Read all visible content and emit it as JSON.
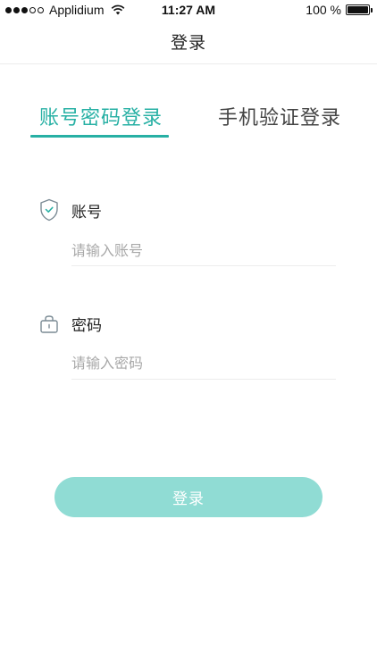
{
  "status_bar": {
    "carrier": "Applidium",
    "time": "11:27 AM",
    "battery": "100 %",
    "signal_icon": "signal-dots-icon",
    "wifi_icon": "wifi-icon",
    "battery_icon": "battery-icon"
  },
  "nav": {
    "title": "登录"
  },
  "tabs": [
    {
      "label": "账号密码登录",
      "active": true
    },
    {
      "label": "手机验证登录",
      "active": false
    }
  ],
  "form": {
    "account": {
      "label": "账号",
      "placeholder": "请输入账号",
      "icon": "shield-icon"
    },
    "password": {
      "label": "密码",
      "placeholder": "请输入密码",
      "icon": "lock-icon"
    }
  },
  "login_button": {
    "label": "登录"
  },
  "colors": {
    "accent": "#27b0a4",
    "button": "#90dcd4",
    "placeholder": "#a8a8a8"
  }
}
